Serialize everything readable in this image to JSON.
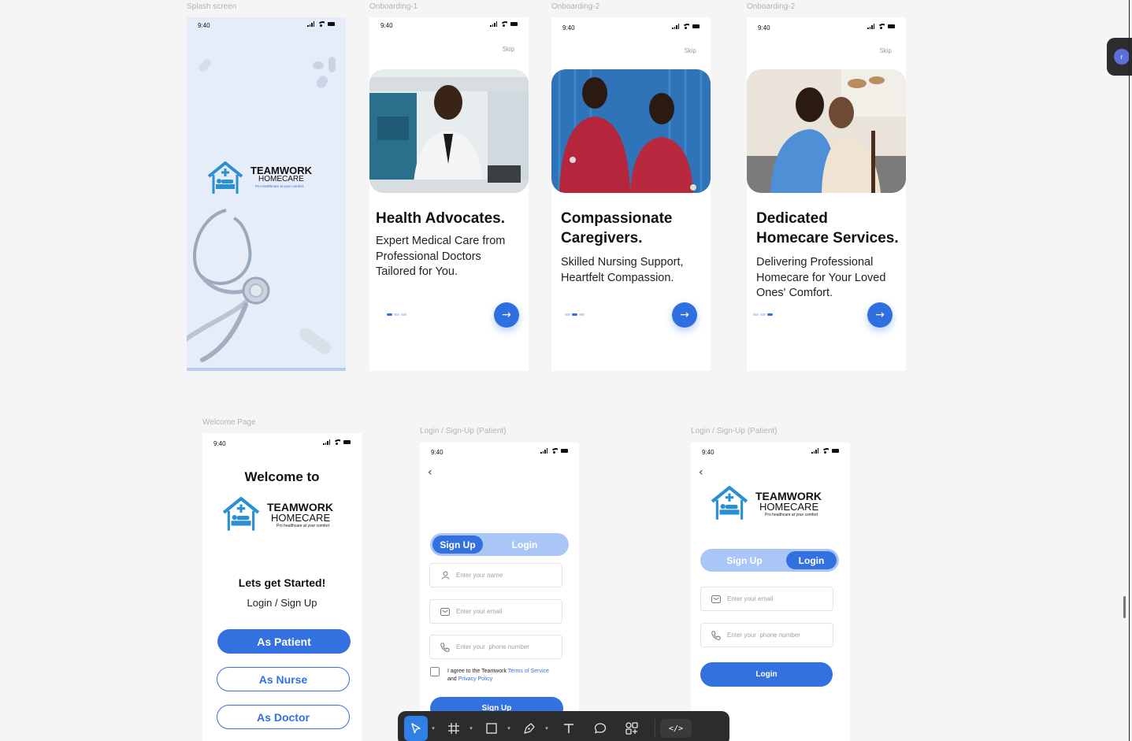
{
  "frames": {
    "splash": {
      "label": "Splash screen",
      "time": "9:40"
    },
    "onboarding1": {
      "label": "Onboarding-1",
      "time": "9:40",
      "skip": "Skip",
      "title": "Health Advocates.",
      "description": "Expert Medical Care from Professional Doctors Tailored for You.",
      "active_dot": 0
    },
    "onboarding2": {
      "label": "Onboarding-2",
      "time": "9:40",
      "skip": "Skip",
      "title": "Compassionate Caregivers.",
      "description": "Skilled Nursing Support, Heartfelt Compassion.",
      "active_dot": 1
    },
    "onboarding3": {
      "label": "Onboarding-2",
      "time": "9:40",
      "skip": "Skip",
      "title": "Dedicated Homecare Services.",
      "description": "Delivering Professional Homecare for Your Loved Ones' Comfort.",
      "active_dot": 2
    },
    "welcome": {
      "label": "Welcome Page",
      "time": "9:40",
      "heading": "Welcome to",
      "subheading": "Lets get Started!",
      "subtitle": "Login / Sign Up",
      "buttons": {
        "patient": "As Patient",
        "nurse": "As Nurse",
        "doctor": "As Doctor"
      }
    },
    "signup": {
      "label": "Login / Sign-Up (Patient)",
      "time": "9:40",
      "tabs": {
        "signup": "Sign Up",
        "login": "Login"
      },
      "name_placeholder": "Enter your name",
      "email_placeholder": "Enter your email",
      "phone_placeholder": "Enter your  phone number",
      "terms_prefix": "I agree to the Teamwork ",
      "terms_link": "Terms of Service",
      "terms_and": " and ",
      "privacy_link": "Privacy Policy",
      "submit": "Sign Up"
    },
    "login": {
      "label": "Login / Sign-Up (Patient)",
      "time": "9:40",
      "tabs": {
        "signup": "Sign Up",
        "login": "Login"
      },
      "email_placeholder": "Enter your email",
      "phone_placeholder": "Enter your  phone number",
      "submit": "Login"
    }
  },
  "logo": {
    "line1": "TEAMWORK",
    "line2": "HOMECARE",
    "tagline_splash": "Pro Healthcare at your comfort",
    "tagline": "Pro healthcare at your comfort"
  },
  "toolbar": {
    "tools": [
      "move-tool",
      "frame-tool",
      "shape-tool",
      "pen-tool",
      "text-tool",
      "comment-tool",
      "components-tool"
    ],
    "dev_mode": "</>"
  },
  "user_avatar": "r",
  "colors": {
    "accent": "#3370e0",
    "toggle_bg": "#a9c6f6",
    "splash_bg": "#e6ecf8"
  }
}
